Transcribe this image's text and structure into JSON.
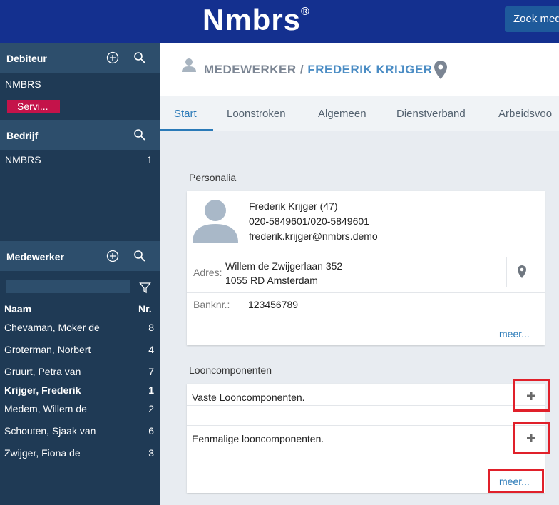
{
  "header": {
    "logo": "Nmbrs",
    "logo_mark": "®",
    "search_button": "Zoek med"
  },
  "sidebar": {
    "debiteur": {
      "title": "Debiteur",
      "name": "NMBRS",
      "badge": "Servi..."
    },
    "bedrijf": {
      "title": "Bedrijf",
      "name": "NMBRS",
      "count": "1"
    },
    "medewerker": {
      "title": "Medewerker",
      "col_name": "Naam",
      "col_nr": "Nr.",
      "employees": [
        {
          "name": "Chevaman, Moker de",
          "nr": "8"
        },
        {
          "name": "Groterman, Norbert",
          "nr": "4"
        },
        {
          "name": "Gruurt, Petra van",
          "nr": "7"
        },
        {
          "name": "Krijger, Frederik",
          "nr": "1"
        },
        {
          "name": "Medem, Willem de",
          "nr": "2"
        },
        {
          "name": "Schouten, Sjaak van",
          "nr": "6"
        },
        {
          "name": "Zwijger, Fiona de",
          "nr": "3"
        }
      ]
    }
  },
  "breadcrumb": {
    "section": "MEDEWERKER",
    "separator": "/",
    "employee": "FREDERIK KRIJGER"
  },
  "tabs": [
    "Start",
    "Loonstroken",
    "Algemeen",
    "Dienstverband",
    "Arbeidsvoo"
  ],
  "personalia": {
    "title": "Personalia",
    "name": "Frederik Krijger (47)",
    "phone": "020-5849601/020-5849601",
    "email": "frederik.krijger@nmbrs.demo",
    "address_label": "Adres:",
    "address_line1": "Willem de Zwijgerlaan 352",
    "address_line2": "1055 RD Amsterdam",
    "bank_label": "Banknr.:",
    "bank_value": "123456789",
    "more": "meer..."
  },
  "looncomponenten": {
    "title": "Looncomponenten",
    "rows": [
      "Vaste Looncomponenten.",
      "Eenmalige looncomponenten."
    ],
    "more": "meer..."
  },
  "colors": {
    "header": "#14308f",
    "sidebar": "#1f3a55",
    "accent": "#2a7ab8",
    "badge": "#c4134a",
    "highlight": "#e0202a"
  }
}
